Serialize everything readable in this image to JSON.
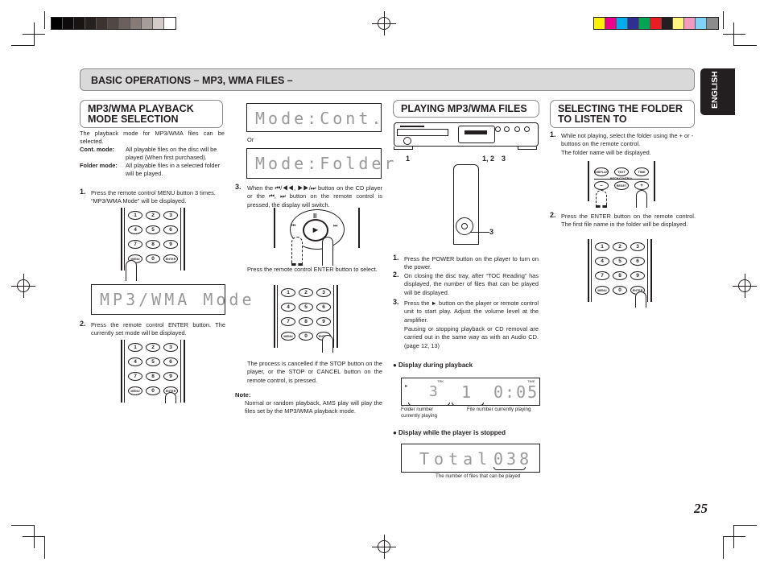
{
  "print_marks": {
    "grayscale_swatches": [
      "#000000",
      "#0d0b0b",
      "#181414",
      "#26211f",
      "#3d3432",
      "#514744",
      "#6b605d",
      "#877b78",
      "#a69c99",
      "#d3cbca",
      "#ffffff"
    ],
    "color_swatches": [
      "#fff200",
      "#ec008c",
      "#00aeef",
      "#2e3192",
      "#00a651",
      "#ed1c24",
      "#231f20",
      "#fff57d",
      "#f49ac1",
      "#7fd3f7",
      "#8c8c8c"
    ]
  },
  "banner": {
    "title": "BASIC OPERATIONS  – MP3, WMA FILES –"
  },
  "language_tab": "ENGLISH",
  "page_number": "25",
  "section_mode": {
    "heading_line1": "MP3/WMA PLAYBACK",
    "heading_line2": "MODE SELECTION",
    "intro": "The playback mode for MP3/WMA files can be selected.",
    "defs": [
      {
        "term": "Cont. mode:",
        "desc": "All playable files on the disc will be played (When first purchased)."
      },
      {
        "term": "Folder mode:",
        "desc": "All playable files in a selected folder will be played."
      }
    ],
    "step1": {
      "num": "1.",
      "text": "Press the remote control MENU button 3 times. “MP3/WMA Mode” will be displayed."
    },
    "lcd_mode": "MP3/WMA Mode",
    "step2": {
      "num": "2.",
      "text": "Press the remote control ENTER button. The currently set mode will be displayed."
    },
    "lcd_cont": "Mode:Cont.",
    "or_label": "Or",
    "lcd_folder": "Mode:Folder",
    "step3": {
      "num": "3.",
      "text": "When the ⏮/◀◀, ▶▶/⏭ button on the CD player or the ⏮, ⏭ button on the remote control is pressed, the display will switch."
    },
    "enter_text": "Press the remote control ENTER button to select.",
    "cancel_text": "The process is cancelled if the STOP button on the player, or the STOP or CANCEL button on the remote control, is pressed.",
    "note_label": "Note:",
    "note_text": "Normal or random playback, AMS play will play the files set by the MP3/WMA playback mode."
  },
  "keypad": {
    "keys": [
      "1",
      "2",
      "3",
      "4",
      "5",
      "6",
      "7",
      "8",
      "9",
      "MENU",
      "0",
      "ENTER"
    ]
  },
  "section_playing": {
    "heading": "PLAYING MP3/WMA FILES",
    "callouts": {
      "power": "1",
      "tray": "1, 2",
      "play": "3",
      "remote": "3"
    },
    "steps": [
      {
        "num": "1.",
        "text": "Press the POWER button on the player to turn on the power."
      },
      {
        "num": "2.",
        "text": "On closing the disc tray, after “TOC Reading” has displayed, the number of files that can be played will be displayed."
      },
      {
        "num": "3.",
        "text": "Press the ► button on the player or remote control unit to start play.  Adjust the volume level at the amplifier."
      }
    ],
    "pause_text": "Pausing or stopping playback or CD removal are carried out in the same way as with an Audio CD. (page 12, 13)",
    "display_playing": {
      "heading": "● Display during playback",
      "play_indicator": "►",
      "trk_label": "TRK",
      "time_label": "TIME",
      "folder": "3",
      "file": "1",
      "time": "0:05",
      "folder_caption": "Folder number currently playing",
      "file_caption": "File number currently playing"
    },
    "display_stopped": {
      "heading": "● Display while the player is stopped",
      "lcd_label": "Total",
      "lcd_value": "038",
      "caption": "The number of files that can be played"
    }
  },
  "section_folder": {
    "heading_line1": "SELECTING THE FOLDER",
    "heading_line2": "TO LISTEN TO",
    "step1": {
      "num": "1.",
      "text": "While not playing, select the folder using the + or - buttons on the remote control."
    },
    "step1_sub": "The folder name will be displayed.",
    "remote_keys": [
      "DISPLAY",
      "TEXT",
      "TIME",
      "–",
      "RESET",
      "+"
    ],
    "remote_group_label": "PITCH CONTROL",
    "step2": {
      "num": "2.",
      "text": "Press the ENTER button on the remote control. The first file name in the folder will be displayed."
    }
  }
}
